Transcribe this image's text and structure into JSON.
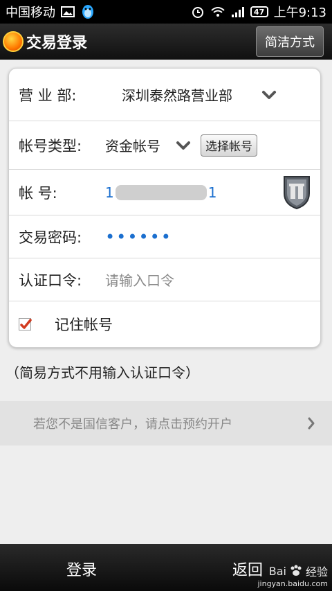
{
  "status_bar": {
    "carrier": "中国移动",
    "battery": "47",
    "time": "上午9:13",
    "icons": [
      "image-icon",
      "qq-penguin-icon",
      "alarm-icon",
      "wifi-icon",
      "signal-icon",
      "battery-icon"
    ]
  },
  "title_bar": {
    "title": "交易登录",
    "simple_mode_label": "简洁方式"
  },
  "form": {
    "branch_label": "营 业 部:",
    "branch_value": "深圳泰然路营业部",
    "account_type_label": "帐号类型:",
    "account_type_value": "资金帐号",
    "select_account_label": "选择帐号",
    "account_label": "帐        号:",
    "account_prefix": "1",
    "account_suffix": "1",
    "password_label": "交易密码:",
    "password_value": "••••••",
    "auth_label": "认证口令:",
    "auth_placeholder": "请输入口令",
    "remember_label": "记住帐号",
    "remember_checked": true
  },
  "note": "（简易方式不用输入认证口令）",
  "promo_text": "若您不是国信客户，请点击预约开户",
  "bottom_bar": {
    "login_label": "登录",
    "back_label": "返回"
  },
  "watermark": {
    "brand": "Bai",
    "brand_suffix": "经验",
    "url": "jingyan.baidu.com"
  },
  "colors": {
    "accent_blue": "#1b6fcf",
    "checkbox_red": "#d23a1e",
    "title_bar": "#1a1a1a"
  }
}
